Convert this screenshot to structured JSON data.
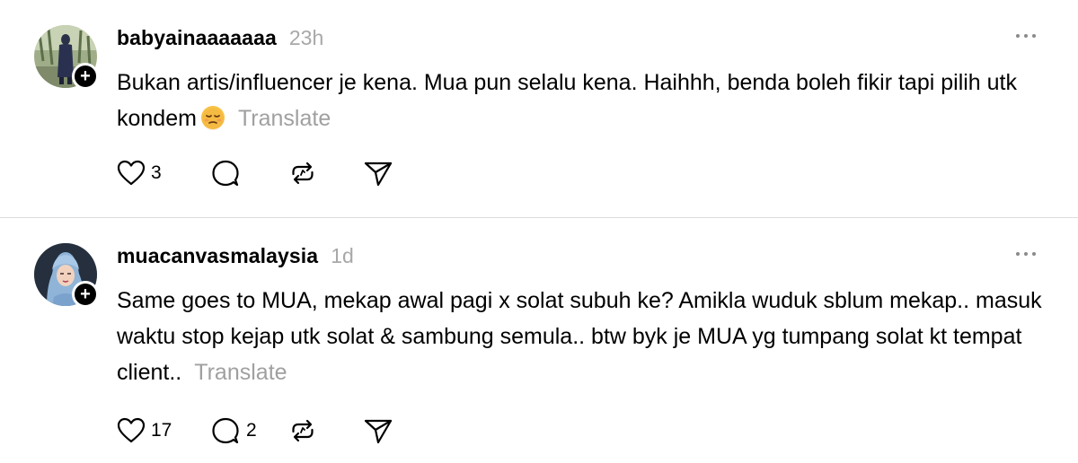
{
  "posts": [
    {
      "username": "babyainaaaaaaa",
      "timestamp": "23h",
      "text": "Bukan artis/influencer je kena. Mua pun selalu kena. Haihhh, benda boleh fikir tapi pilih utk kondem",
      "emoji": "pensive-face",
      "translate_label": "Translate",
      "likes": "3",
      "replies": "",
      "icons": [
        "heart-icon",
        "comment-icon",
        "repost-icon",
        "send-icon",
        "more-icon",
        "plus-icon"
      ]
    },
    {
      "username": "muacanvasmalaysia",
      "timestamp": "1d",
      "text": "Same goes to MUA, mekap awal pagi x solat subuh ke? Amikla wuduk sblum mekap.. masuk waktu stop kejap utk solat & sambung semula.. btw byk je MUA yg tumpang solat kt tempat client..",
      "translate_label": "Translate",
      "likes": "17",
      "replies": "2",
      "icons": [
        "heart-icon",
        "comment-icon",
        "repost-icon",
        "send-icon",
        "more-icon",
        "plus-icon"
      ]
    }
  ],
  "colors": {
    "text": "#000000",
    "muted": "#a8a8a8",
    "divider": "#dcdcdc",
    "badge": "#000000"
  }
}
